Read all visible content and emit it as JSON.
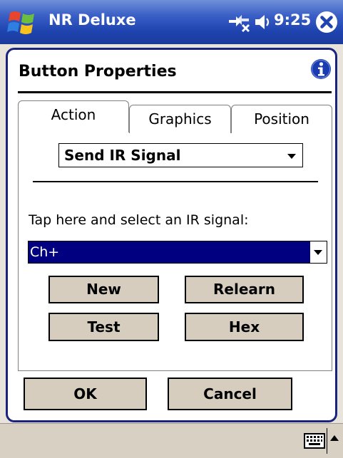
{
  "titlebar": {
    "app_name": "NR Deluxe",
    "time": "9:25",
    "icons": {
      "start": "windows-flag-icon",
      "connectivity": "connectivity-icon",
      "volume": "volume-icon",
      "close": "close-icon"
    }
  },
  "dialog": {
    "title": "Button Properties",
    "info_icon": "info-icon",
    "tabs": [
      {
        "label": "Action",
        "active": true
      },
      {
        "label": "Graphics",
        "active": false
      },
      {
        "label": "Position",
        "active": false
      }
    ],
    "action_dropdown": {
      "value": "Send IR Signal"
    },
    "instruction": "Tap here and select an IR signal:",
    "signal_dropdown": {
      "value": "Ch+"
    },
    "buttons": {
      "new": "New",
      "relearn": "Relearn",
      "test": "Test",
      "hex": "Hex"
    },
    "ok": "OK",
    "cancel": "Cancel"
  },
  "bottombar": {
    "keyboard_icon": "keyboard-icon",
    "sip_toggle_icon": "up-arrow-icon"
  },
  "colors": {
    "titlebar": "#2a4fb8",
    "dialog_border": "#1a237e",
    "selection": "#000080",
    "button_face": "#d6cdbf",
    "bottombar": "#d8d0c2"
  }
}
